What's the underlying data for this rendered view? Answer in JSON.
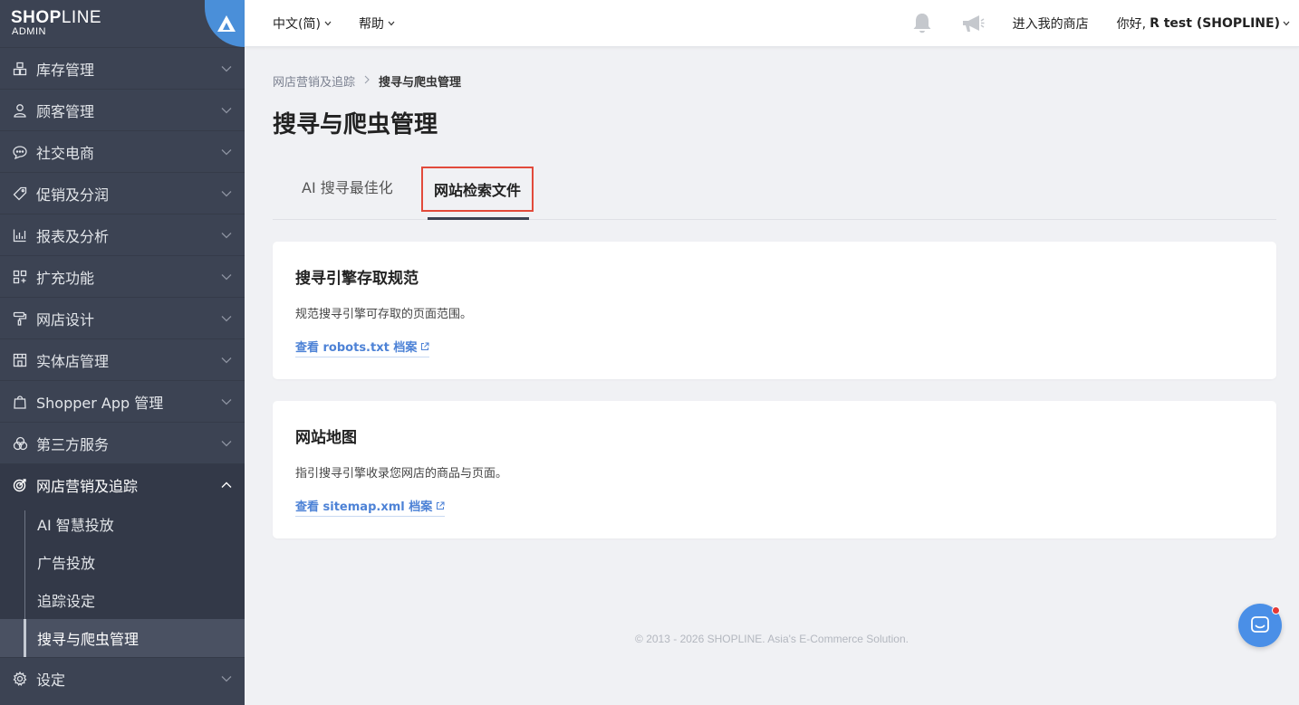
{
  "brand": {
    "logo_main": "SHOPLINE",
    "logo_bold": "SHOP",
    "logo_light": "LINE",
    "logo_sub": "ADMIN"
  },
  "sidebar": {
    "items": [
      {
        "label": "库存管理",
        "icon": "inventory-icon"
      },
      {
        "label": "顾客管理",
        "icon": "user-icon"
      },
      {
        "label": "社交电商",
        "icon": "chat-bubble-icon"
      },
      {
        "label": "促销及分润",
        "icon": "tag-icon"
      },
      {
        "label": "报表及分析",
        "icon": "bar-chart-icon"
      },
      {
        "label": "扩充功能",
        "icon": "apps-grid-icon"
      },
      {
        "label": "网店设计",
        "icon": "paint-roller-icon"
      },
      {
        "label": "实体店管理",
        "icon": "store-icon"
      },
      {
        "label": "Shopper App 管理",
        "icon": "shopping-bag-icon"
      },
      {
        "label": "第三方服务",
        "icon": "circles-icon"
      },
      {
        "label": "网店营销及追踪",
        "icon": "target-icon"
      }
    ],
    "sub_items": [
      {
        "label": "AI 智慧投放"
      },
      {
        "label": "广告投放"
      },
      {
        "label": "追踪设定"
      },
      {
        "label": "搜寻与爬虫管理"
      }
    ],
    "settings": {
      "label": "设定",
      "icon": "gear-icon"
    }
  },
  "topbar": {
    "language": "中文(简)",
    "help": "帮助",
    "enter_store": "进入我的商店",
    "greeting": "你好,",
    "user_name": "R test (SHOPLINE)"
  },
  "breadcrumb": {
    "parent": "网店营销及追踪",
    "separator": ">",
    "current": "搜寻与爬虫管理"
  },
  "page_title": "搜寻与爬虫管理",
  "tabs": [
    {
      "label": "AI 搜寻最佳化"
    },
    {
      "label": "网站检索文件"
    }
  ],
  "cards": [
    {
      "title": "搜寻引擎存取规范",
      "description": "规范搜寻引擎可存取的页面范围。",
      "link": "查看 robots.txt 档案"
    },
    {
      "title": "网站地图",
      "description": "指引搜寻引擎收录您网店的商品与页面。",
      "link": "查看 sitemap.xml 档案"
    }
  ],
  "footer": "© 2013 - 2026 SHOPLINE. Asia's E-Commerce Solution.",
  "colors": {
    "sidebar_bg": "#3c4353",
    "accent_blue": "#4d82d6",
    "highlight_red": "#e24a3b",
    "chat_blue": "#4a8fe7"
  }
}
